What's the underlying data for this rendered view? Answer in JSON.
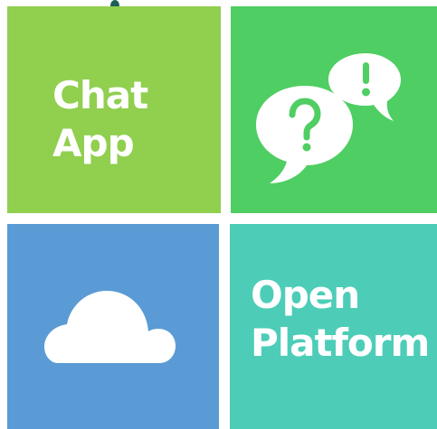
{
  "tiles": {
    "chat": {
      "line1": "Chat",
      "line2": "App",
      "color": "#91CF4F"
    },
    "bubbles": {
      "icon": "speech-bubbles-question-exclamation-icon",
      "color": "#4FCE63"
    },
    "cloud": {
      "icon": "cloud-icon",
      "color": "#5A9BD5"
    },
    "platform": {
      "line1": "Open",
      "line2": "Platform",
      "color": "#4DCDB8"
    }
  },
  "marker": {
    "color": "#1E5E58"
  }
}
